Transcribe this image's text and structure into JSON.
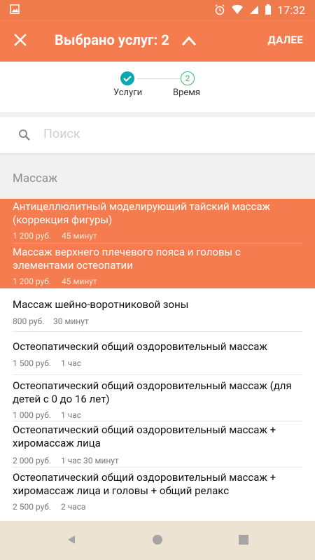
{
  "status": {
    "time": "17:32",
    "icons": [
      "image-icon",
      "alarm-icon",
      "wifi-icon",
      "signal-icon",
      "battery-icon"
    ]
  },
  "appbar": {
    "title": "Выбрано услуг: 2",
    "action": "ДАЛЕЕ"
  },
  "stepper": {
    "steps": [
      {
        "label": "Услуги",
        "state": "done"
      },
      {
        "label": "Время",
        "number": "2",
        "state": "next"
      }
    ]
  },
  "search": {
    "placeholder": "Поиск"
  },
  "section": {
    "title": "Массаж"
  },
  "services": [
    {
      "name": "Антицеллюлитный моделирующий тайский массаж (коррекция фигуры)",
      "price": "1 200 руб.",
      "duration": "45 минут",
      "selected": true
    },
    {
      "name": "Массаж верхнего плечевого пояса и головы с элементами остеопатии",
      "price": "1 200 руб.",
      "duration": "45 минут",
      "selected": true
    },
    {
      "name": "Массаж шейно-воротниковой зоны",
      "price": "800 руб.",
      "duration": "30 минут",
      "selected": false
    },
    {
      "name": "Остеопатический общий оздоровительный массаж",
      "price": "1 500 руб.",
      "duration": "1 час",
      "selected": false
    },
    {
      "name": "Остеопатический общий оздоровительный массаж (для детей с 0 до 16 лет)",
      "price": "1 000 руб.",
      "duration": "1 час",
      "selected": false
    },
    {
      "name": "Остеопатический общий оздоровительный массаж + хиромассаж лица",
      "price": "2 000 руб.",
      "duration": "1 час 30 минут",
      "selected": false
    },
    {
      "name": "Остеопатический общий оздоровительный массаж + хиромассаж лица и головы + общий релакс",
      "price": "2 500 руб.",
      "duration": "2 часа",
      "selected": false
    }
  ],
  "colors": {
    "accent": "#f47c4f",
    "step_done": "#0aa8b0",
    "step_next": "#35b86b"
  }
}
